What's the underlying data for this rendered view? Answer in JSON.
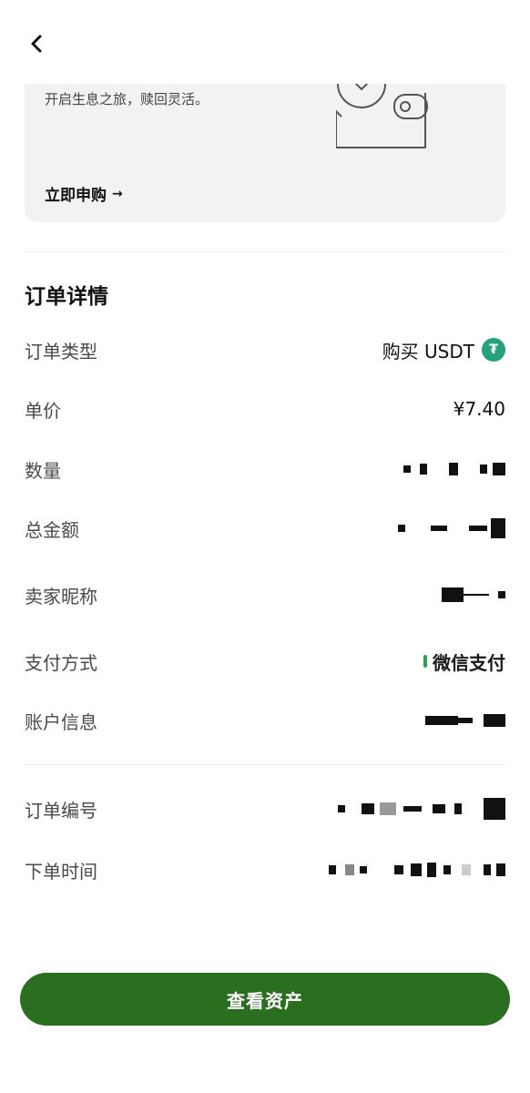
{
  "promo": {
    "description": "开启生息之旅，赎回灵活。",
    "cta_label": "立即申购",
    "cta_arrow": "→"
  },
  "order": {
    "section_title": "订单详情",
    "rows": [
      {
        "label": "订单类型",
        "value": "购买 USDT"
      },
      {
        "label": "单价",
        "value": "¥7.40"
      },
      {
        "label": "数量",
        "value": ""
      },
      {
        "label": "总金额",
        "value": ""
      },
      {
        "label": "卖家昵称",
        "value": ""
      },
      {
        "label": "支付方式",
        "value": "微信支付"
      },
      {
        "label": "账户信息",
        "value": ""
      }
    ],
    "meta_rows": [
      {
        "label": "订单编号",
        "value": ""
      },
      {
        "label": "下单时间",
        "value": ""
      }
    ]
  },
  "icons": {
    "back": "chevron-left-icon",
    "usdt": "tether-usdt-icon",
    "wallet": "wallet-illustration-icon"
  },
  "colors": {
    "primary_button": "#2a6e1f",
    "usdt_green": "#26a17b",
    "wechat_green": "#2aa24a",
    "card_bg": "#f2f2f2"
  },
  "footer": {
    "button_label": "查看资产"
  }
}
